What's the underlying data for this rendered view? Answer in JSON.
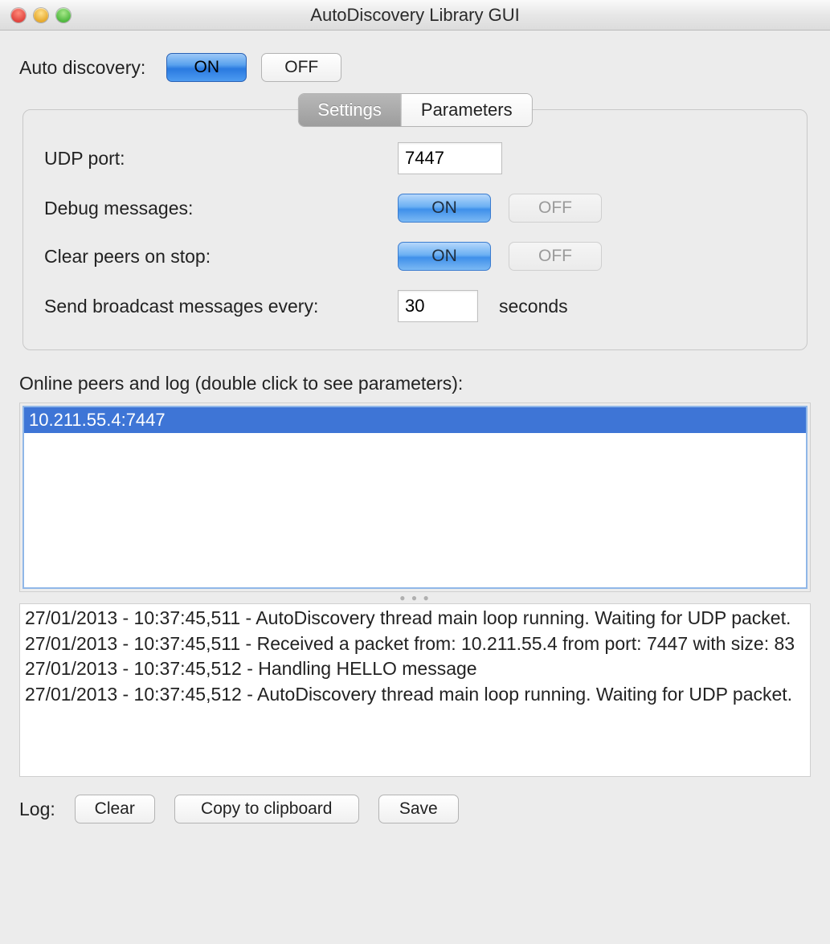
{
  "window": {
    "title": "AutoDiscovery Library GUI"
  },
  "top": {
    "label": "Auto discovery:",
    "on": "ON",
    "off": "OFF"
  },
  "tabs": {
    "settings": "Settings",
    "parameters": "Parameters"
  },
  "settings": {
    "udp_port_label": "UDP port:",
    "udp_port_value": "7447",
    "debug_label": "Debug messages:",
    "debug_on": "ON",
    "debug_off": "OFF",
    "clear_peers_label": "Clear peers on stop:",
    "clear_on": "ON",
    "clear_off": "OFF",
    "broadcast_label": "Send broadcast messages every:",
    "broadcast_value": "30",
    "broadcast_suffix": "seconds"
  },
  "peers_section_label": "Online peers and log (double click to see parameters):",
  "peers": [
    "10.211.55.4:7447"
  ],
  "log_lines": [
    "27/01/2013 - 10:37:45,511 - AutoDiscovery thread main loop running. Waiting for UDP packet.",
    "27/01/2013 - 10:37:45,511 - Received a packet from: 10.211.55.4 from port: 7447 with size: 83",
    "27/01/2013 - 10:37:45,512 - Handling HELLO message",
    "27/01/2013 - 10:37:45,512 - AutoDiscovery thread main loop running. Waiting for UDP packet."
  ],
  "bottom": {
    "log_label": "Log:",
    "clear": "Clear",
    "copy": "Copy to clipboard",
    "save": "Save"
  }
}
